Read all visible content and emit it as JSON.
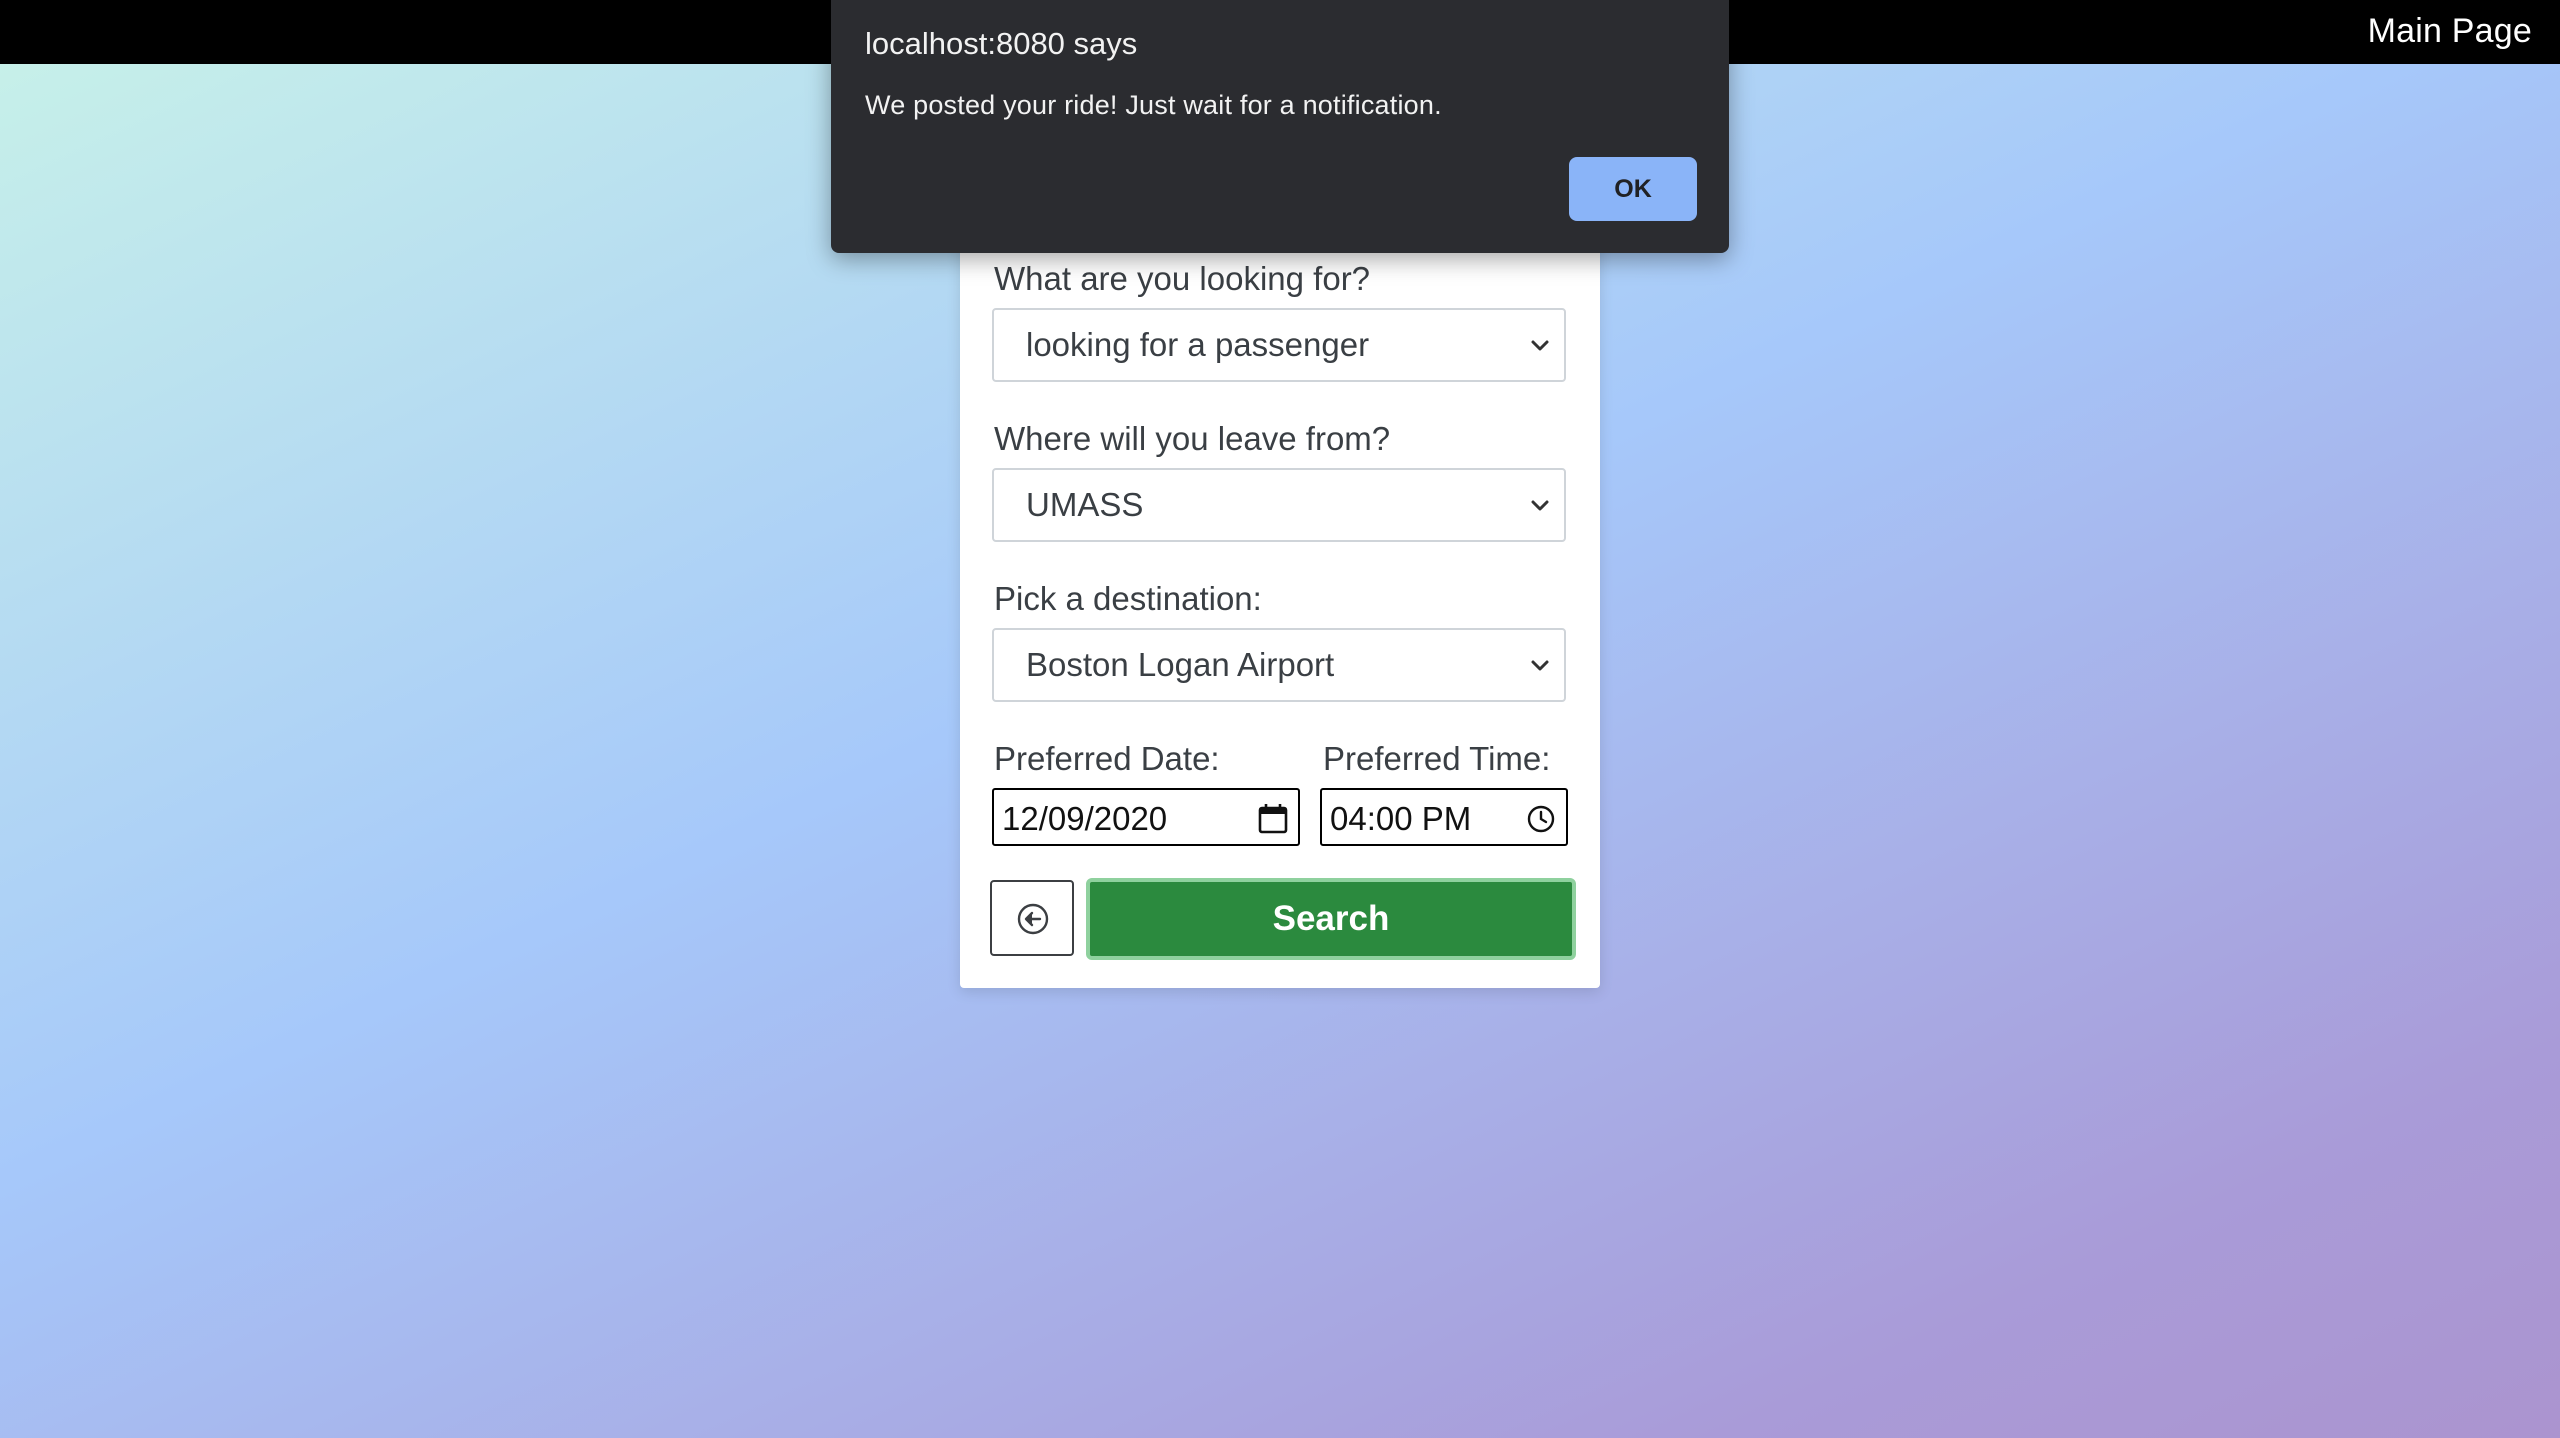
{
  "topbar": {
    "main_page_link": "Main Page"
  },
  "form": {
    "looking_for": {
      "label": "What are you looking for?",
      "value": "looking for a passenger"
    },
    "leave_from": {
      "label": "Where will you leave from?",
      "value": "UMASS"
    },
    "destination": {
      "label": "Pick a destination:",
      "value": "Boston Logan Airport"
    },
    "date": {
      "label": "Preferred Date:",
      "value": "12/09/2020"
    },
    "time": {
      "label": "Preferred Time:",
      "value": "04:00 PM"
    },
    "search_label": "Search"
  },
  "dialog": {
    "title": "localhost:8080 says",
    "message": "We posted your ride! Just wait for a notification.",
    "ok_label": "OK"
  },
  "icons": {
    "back": "arrow-left-circle-icon",
    "calendar": "calendar-icon",
    "clock": "clock-icon",
    "chevron": "chevron-down-icon"
  },
  "colors": {
    "search_button": "#2b8a3e",
    "search_button_focus": "#8fd19e",
    "dialog_background": "#2b2c30",
    "dialog_ok": "#8ab4f8",
    "topbar": "#000000"
  }
}
